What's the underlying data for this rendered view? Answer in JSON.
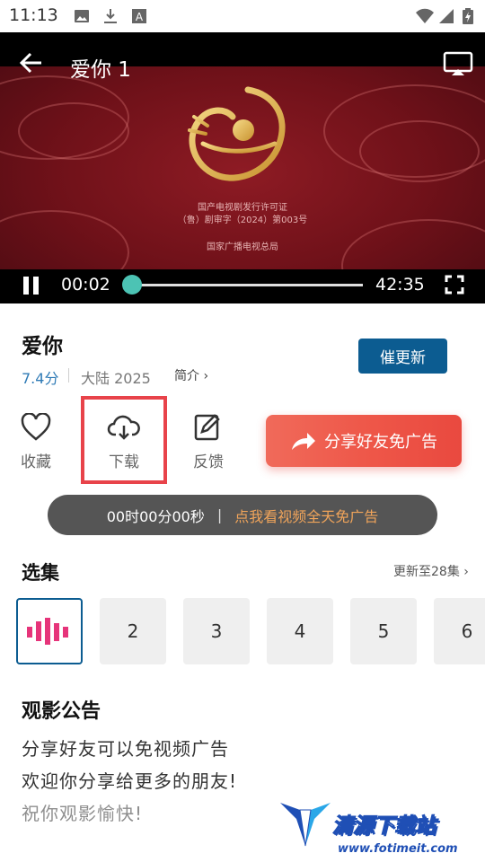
{
  "status_bar": {
    "time": "11:13",
    "icons": [
      "image-icon",
      "download-icon",
      "a-icon",
      "wifi-icon",
      "signal-icon",
      "battery-icon"
    ]
  },
  "player": {
    "title": "爱你 1",
    "current_time": "00:02",
    "duration": "42:35",
    "progress": 0.0,
    "license_lines": [
      "国产电视剧发行许可证",
      "（鲁）剧审字（2024）第003号",
      "国家广播电视总局"
    ],
    "icons": [
      "back-arrow-icon",
      "cast-icon",
      "pause-icon",
      "fullscreen-icon"
    ]
  },
  "show": {
    "title": "爱你",
    "rating": "7.4分",
    "region_year": "大陆  2025",
    "intro_label": "简介 ›",
    "urge_button": "催更新"
  },
  "actions": {
    "favorite": "收藏",
    "download": "下载",
    "feedback": "反馈",
    "share": "分享好友免广告"
  },
  "timer_bar": {
    "time": "00时00分00秒",
    "separator": "|",
    "promo": "点我看视频全天免广告"
  },
  "episodes": {
    "heading": "选集",
    "more": "更新至28集 ›",
    "items": [
      "",
      "2",
      "3",
      "4",
      "5",
      "6"
    ]
  },
  "notice": {
    "heading": "观影公告",
    "lines": [
      "分享好友可以免视频广告",
      "欢迎你分享给更多的朋友!",
      "祝你观影愉快!"
    ]
  },
  "watermark": {
    "brand": "清源下载站",
    "url": "www.fotimeit.com"
  },
  "colors": {
    "accent_blue": "#0c5c91",
    "share_red": "#ee5648",
    "highlight_red": "#e8434a",
    "seek_teal": "#4cc3b4",
    "promo_orange": "#f0a45a"
  }
}
